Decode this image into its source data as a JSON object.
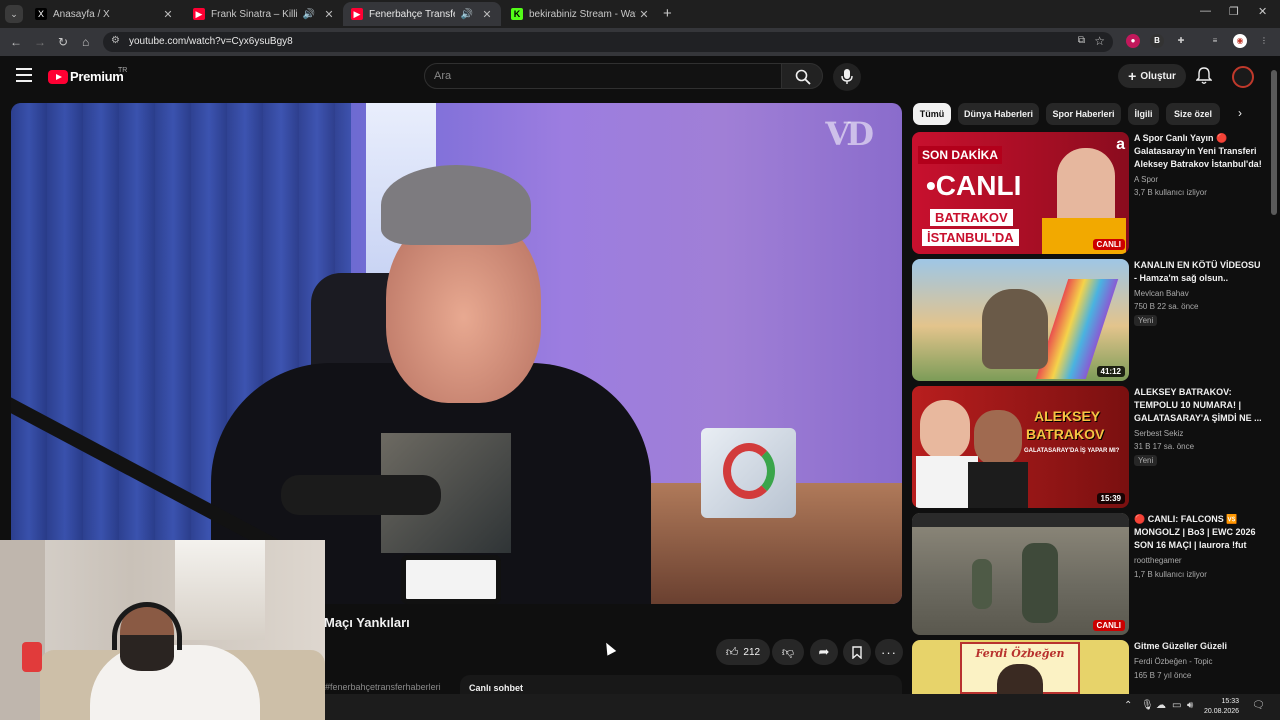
{
  "browser": {
    "tabs": [
      {
        "title": "Anasayfa / X",
        "favicon": "X",
        "fav_color": "#ffffff",
        "fav_bg": "#000000",
        "close": "✕"
      },
      {
        "title": "Frank Sinatra – Killing Me S",
        "favicon": "▶",
        "fav_color": "#ffffff",
        "fav_bg": "#ff0033",
        "close": "✕"
      },
      {
        "title": "Fenerbahçe Transferleri Ne",
        "favicon": "▶",
        "fav_color": "#ffffff",
        "fav_bg": "#ff0033",
        "close": "✕"
      },
      {
        "title": "bekirabiniz Stream - Watch Live",
        "favicon": "K",
        "fav_color": "#000000",
        "fav_bg": "#53fc18",
        "close": "✕"
      }
    ],
    "url": "youtube.com/watch?v=Cyx6ysuBgy8"
  },
  "header": {
    "logo_text": "Premium",
    "country": "TR",
    "search_placeholder": "Ara",
    "create_label": "Oluştur"
  },
  "video": {
    "title": "Maçı Yankıları",
    "like_count": "212",
    "hashtag": "#fenerbahçetransferhaberleri",
    "live_chat_label": "Canlı sohbet"
  },
  "chips": [
    "Tümü",
    "Dünya Haberleri",
    "Spor Haberleri",
    "İlgili",
    "Size özel"
  ],
  "recommendations": [
    {
      "title": "A Spor Canlı Yayın 🔴 Galatasaray'ın Yeni Transferi Aleksey Batrakov İstanbul'da!",
      "channel": "A Spor",
      "meta": "3,7 B kullanıcı izliyor",
      "badge": "CANLI",
      "live": true,
      "new": "",
      "thumb_text_1": "SON DAKİKA",
      "thumb_text_2": "•CANLI",
      "thumb_text_3": "BATRAKOV",
      "thumb_text_4": "İSTANBUL'DA"
    },
    {
      "title": "KANALIN EN KÖTÜ VİDEOSU - Hamza'm sağ olsun..",
      "channel": "Mevlcan Bahav",
      "meta": "750 B   22 sa. önce",
      "badge": "41:12",
      "live": false,
      "new": "Yeni"
    },
    {
      "title": "ALEKSEY BATRAKOV: TEMPOLU 10 NUMARA! | GALATASARAY'A ŞİMDİ NE ...",
      "channel": "Serbest Sekiz",
      "meta": "31 B   17 sa. önce",
      "badge": "15:39",
      "live": false,
      "new": "Yeni",
      "thumb_text_1": "ALEKSEY",
      "thumb_text_2": "BATRAKOV",
      "thumb_text_3": "GALATASARAY'DA İŞ YAPAR MI?"
    },
    {
      "title": "🔴 CANLI: FALCONS 🆚 MONGOLZ | Bo3 | EWC 2026 SON 16 MAÇI | Iaurora !fut",
      "channel": "rootthegamer",
      "meta": "1,7 B kullanıcı izliyor",
      "badge": "CANLI",
      "live": true,
      "new": ""
    },
    {
      "title": "Gitme Güzeller Güzeli",
      "channel": "Ferdi Özbeğen - Topic",
      "meta": "165 B   7 yıl önce",
      "badge": "",
      "live": false,
      "new": "",
      "thumb_text_1": "Ferdi Özbeğen"
    }
  ],
  "taskbar": {
    "time": "15:33",
    "date": "20.08.2026"
  }
}
